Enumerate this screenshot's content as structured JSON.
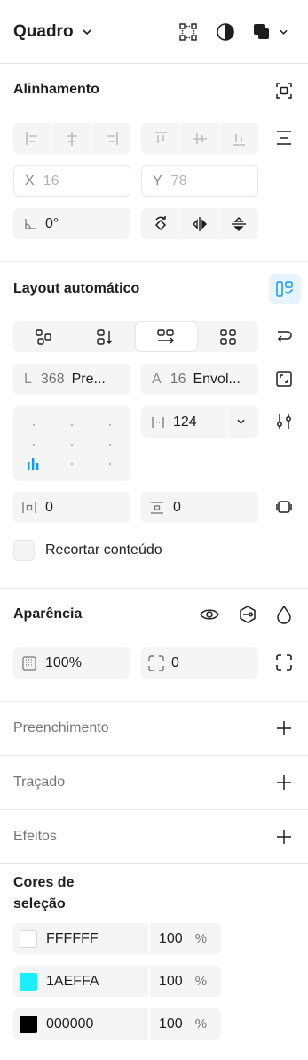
{
  "header": {
    "title": "Quadro"
  },
  "alignment": {
    "title": "Alinhamento",
    "x_label": "X",
    "x_value": "16",
    "y_label": "Y",
    "y_value": "78",
    "rotation_value": "0°"
  },
  "auto_layout": {
    "title": "Layout automático",
    "width_label": "L",
    "width_value": "368",
    "width_mode": "Pre...",
    "height_label": "A",
    "height_value": "16",
    "height_mode": "Envol...",
    "gap_value": "124",
    "padding_h_value": "0",
    "padding_v_value": "0",
    "clip_label": "Recortar conteúdo"
  },
  "appearance": {
    "title": "Aparência",
    "opacity_value": "100%",
    "radius_value": "0"
  },
  "fill": {
    "title": "Preenchimento"
  },
  "stroke": {
    "title": "Traçado"
  },
  "effects": {
    "title": "Efeitos"
  },
  "selection_colors": {
    "title_line1": "Cores de",
    "title_line2": "seleção",
    "colors": [
      {
        "hex": "FFFFFF",
        "opacity": "100",
        "unit": "%",
        "color": "#FFFFFF"
      },
      {
        "hex": "1AEFFA",
        "opacity": "100",
        "unit": "%",
        "color": "#1AEFFA"
      },
      {
        "hex": "000000",
        "opacity": "100",
        "unit": "%",
        "color": "#000000"
      }
    ]
  },
  "colors": {
    "accent": "#0d99ff",
    "accent_bg": "#e5f4ff",
    "field_bg": "#f5f5f5",
    "divider": "#e6e6e6"
  }
}
